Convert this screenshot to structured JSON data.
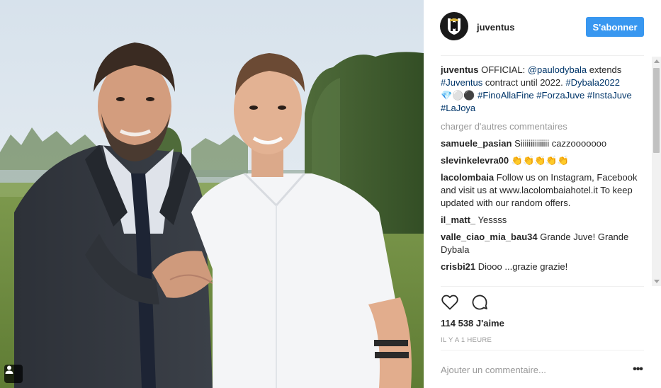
{
  "header": {
    "username": "juventus",
    "follow_label": "S'abonner"
  },
  "caption": {
    "author": "juventus",
    "text_1": " OFFICIAL: ",
    "mention": "@paulodybala",
    "text_2": " extends ",
    "tag_1": "#Juventus",
    "text_3": " contract until 2022. ",
    "tag_2": "#Dybala2022",
    "emoji": "💎⚪⚫ ",
    "tag_3": "#FinoAllaFine",
    "tag_4": "#ForzaJuve",
    "tag_5": "#InstaJuve",
    "tag_6": "#LaJoya"
  },
  "load_more_label": "charger d'autres commentaires",
  "comments": [
    {
      "author": "samuele_pasian",
      "text": "Siiiiiiiiiiiiii cazzooooooo"
    },
    {
      "author": "slevinkelevra00",
      "text": "👏👏👏👏👏"
    },
    {
      "author": "lacolombaia",
      "text": "Follow us on Instagram, Facebook and visit us at www.lacolombaiahotel.it To keep updated with our random offers."
    },
    {
      "author": "il_matt_",
      "text": "Yessss"
    },
    {
      "author": "valle_ciao_mia_bau34",
      "text": "Grande Juve! Grande Dybala"
    },
    {
      "author": "crisbi21",
      "text": "Diooo ...grazie grazie!"
    }
  ],
  "likes_label": "114 538 J'aime",
  "timestamp": "IL Y A 1 HEURE",
  "comment_input": {
    "value": "",
    "placeholder": "Ajouter un commentaire..."
  },
  "more_label": "•••",
  "icons": {
    "like": "heart-icon",
    "comment": "speech-bubble-icon",
    "user_tag": "person-icon",
    "avatar": "juventus-shield-logo"
  },
  "colors": {
    "accent": "#3897f0",
    "link": "#003569",
    "muted": "#999999",
    "text": "#262626"
  }
}
